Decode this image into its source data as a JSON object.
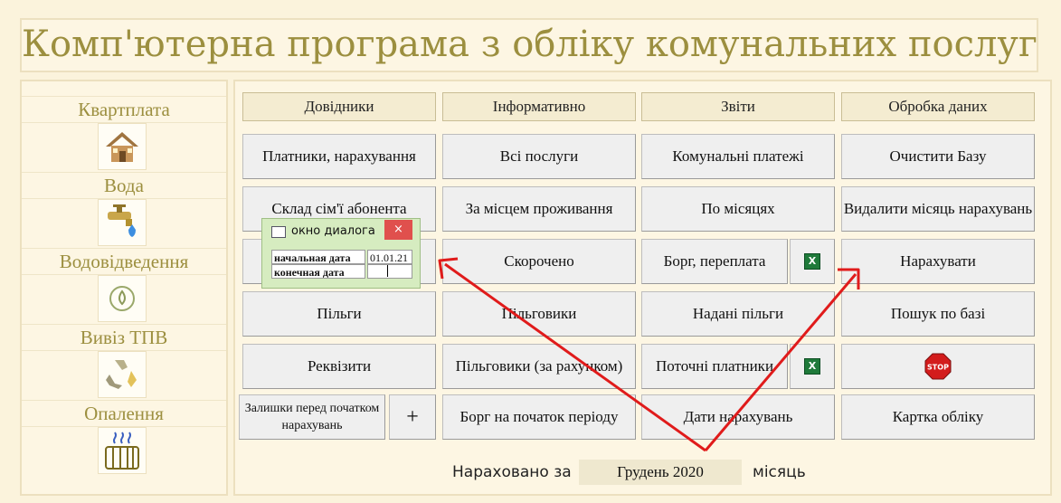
{
  "header": {
    "title": "Комп'ютерна програма з обліку комунальних послуг"
  },
  "sidebar": {
    "items": [
      {
        "label": "Квартплата",
        "icon": "house-icon"
      },
      {
        "label": "Вода",
        "icon": "water-tap-icon"
      },
      {
        "label": "Водовідведення",
        "icon": "recycle-drop-icon"
      },
      {
        "label": "Вивіз ТПВ",
        "icon": "recycle-icon"
      },
      {
        "label": "Опалення",
        "icon": "radiator-icon"
      }
    ]
  },
  "columns": [
    {
      "header": "Довідники",
      "buttons": [
        "Платники, нарахування",
        "Склад сім'ї абонента",
        "",
        "Пільги",
        "Реквізити"
      ],
      "bottom_label": "Залишки перед початком нарахувань",
      "add_label": "+"
    },
    {
      "header": "Інформативно",
      "buttons": [
        "Всі послуги",
        "За місцем проживання",
        "Скорочено",
        "Пільговики",
        "Пільговики (за рахунком)",
        "Борг на початок періоду"
      ]
    },
    {
      "header": "Звіти",
      "buttons": [
        "Комунальні платежі",
        "По місяцях",
        "Борг, переплата",
        "Надані пільги",
        "Поточні платники",
        "Дати  нарахувань"
      ]
    },
    {
      "header": "Обробка даних",
      "buttons": [
        "Очистити Базу",
        "Видалити місяць нарахувань",
        "Нарахувати",
        "Пошук по базі",
        "",
        "Картка обліку"
      ]
    }
  ],
  "stop_icon_label": "STOP",
  "excel_icon_label": "X",
  "status": {
    "prefix": "Нараховано за",
    "month": "Грудень 2020",
    "suffix": "місяць"
  },
  "dialog": {
    "title": "окно диалога",
    "close_label": "×",
    "start_label": "начальная дата",
    "start_value": "01.01.21",
    "end_label": "конечная дата",
    "end_value": ""
  },
  "colors": {
    "title": "#9c8f3f",
    "arrow": "#e01b1b",
    "dialog_bg": "#d6ecc0",
    "close": "#e0504d"
  }
}
